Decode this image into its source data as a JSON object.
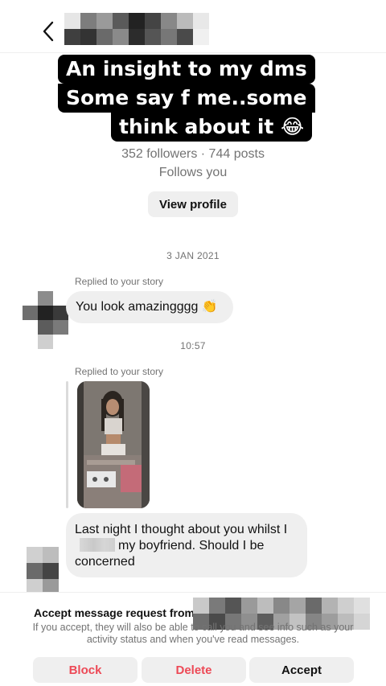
{
  "header": {
    "back_icon": "chevron-left-icon"
  },
  "overlay_caption": {
    "line1": "An insight to my dms",
    "line2": "Some say f me..some",
    "line3": "think about it 😂"
  },
  "profile": {
    "stats": "352 followers · 744 posts",
    "follows_you": "Follows you",
    "view_profile_label": "View profile"
  },
  "thread": {
    "date_stamp": "3 JAN 2021",
    "time_stamp": "10:57",
    "messages": [
      {
        "context": "Replied to your story",
        "text": "You look amazingggg",
        "emoji": "👏"
      },
      {
        "context": "Replied to your story",
        "attachment": "story-photo"
      },
      {
        "text_part1": "Last night I thought about you whilst I",
        "text_part2": "my boyfriend. Should I be concerned"
      }
    ]
  },
  "request": {
    "title": "Accept message request from",
    "description": "If you accept, they will also be able to call you and see info such as your activity status and when you've read messages.",
    "block_label": "Block",
    "delete_label": "Delete",
    "accept_label": "Accept"
  },
  "colors": {
    "danger": "#ed4956",
    "muted": "#737373",
    "bubble": "#efefef"
  }
}
